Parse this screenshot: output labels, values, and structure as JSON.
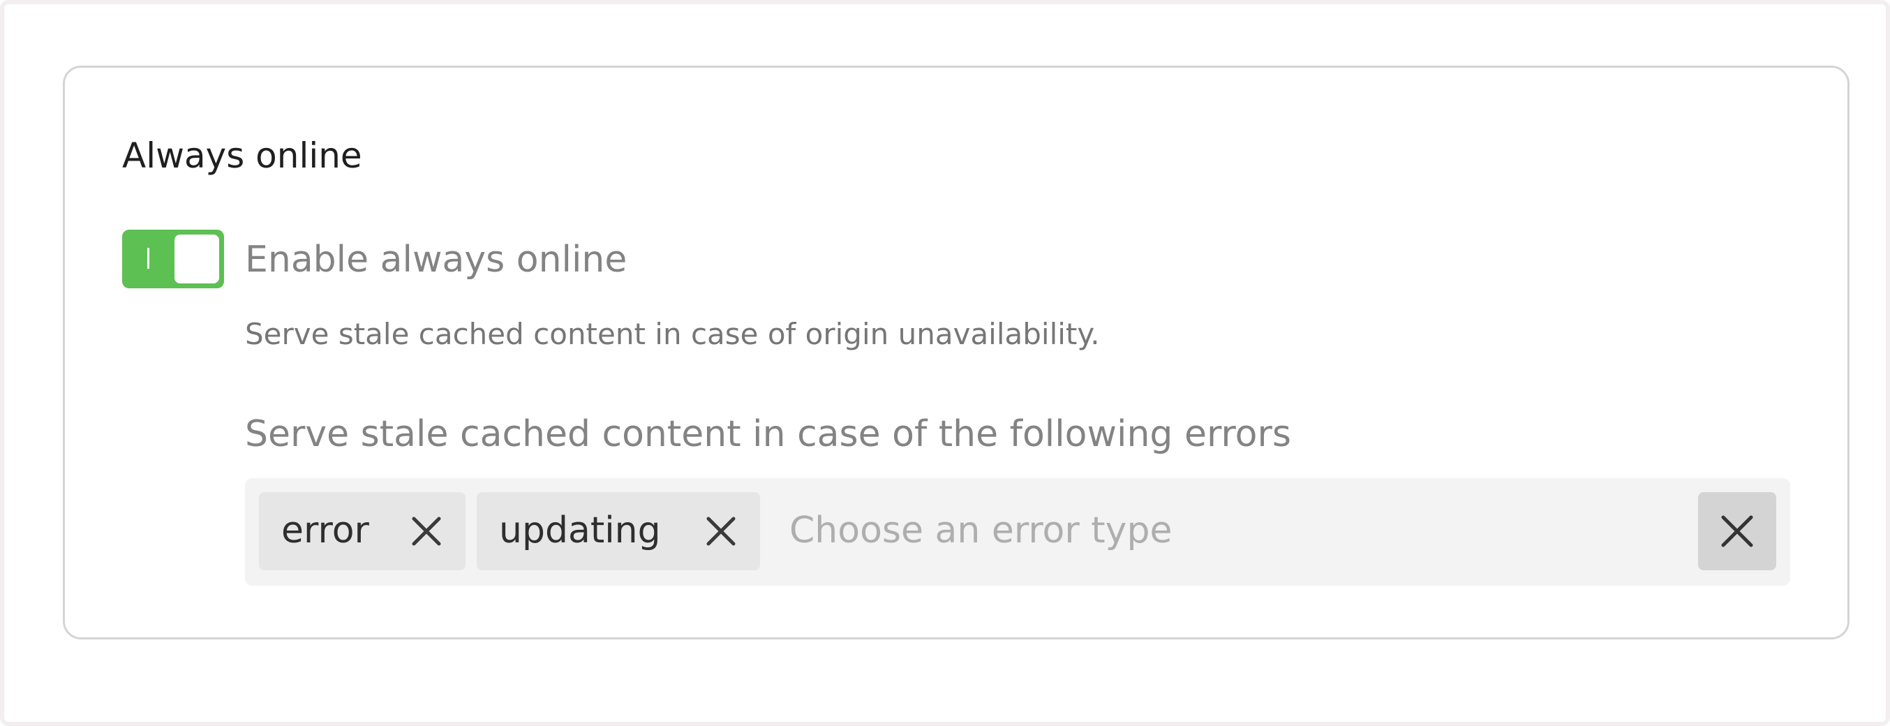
{
  "section": {
    "title": "Always online"
  },
  "toggle": {
    "label": "Enable always online",
    "help": "Serve stale cached content in case of origin unavailability.",
    "enabled": true,
    "color": "#5cc052"
  },
  "errors_field": {
    "label": "Serve stale cached content in case of the following errors",
    "placeholder": "Choose an error type",
    "selected": [
      {
        "label": "error",
        "remove_icon": "close-icon"
      },
      {
        "label": "updating",
        "remove_icon": "close-icon"
      }
    ],
    "clear_icon": "close-icon"
  }
}
